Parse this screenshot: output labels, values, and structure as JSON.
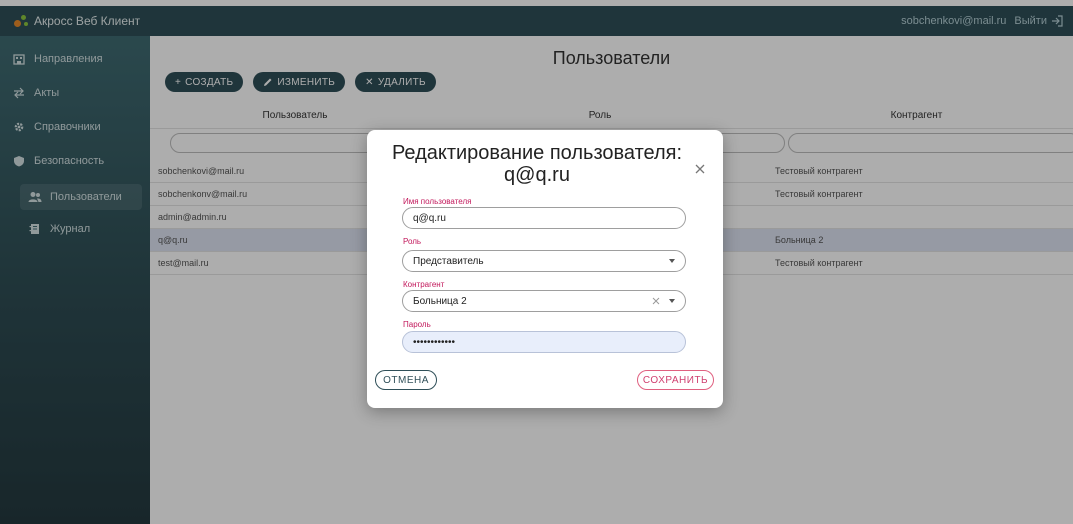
{
  "app": {
    "title": "Акросс Веб Клиент",
    "user_email": "sobchenkovi@mail.ru",
    "logout_label": "Выйти"
  },
  "sidebar": {
    "items": [
      {
        "label": "Направления",
        "icon": "building-icon"
      },
      {
        "label": "Акты",
        "icon": "transfer-icon"
      },
      {
        "label": "Справочники",
        "icon": "gear-icon"
      },
      {
        "label": "Безопасность",
        "icon": "shield-icon"
      },
      {
        "label": "Пользователи",
        "icon": "users-icon",
        "active": true
      },
      {
        "label": "Журнал",
        "icon": "journal-icon"
      }
    ]
  },
  "main": {
    "title": "Пользователи",
    "toolbar": {
      "create_label": "СОЗДАТЬ",
      "edit_label": "ИЗМЕНИТЬ",
      "delete_label": "УДАЛИТЬ"
    },
    "table": {
      "columns": [
        "Пользователь",
        "Роль",
        "Контрагент"
      ],
      "rows": [
        {
          "user": "sobchenkovi@mail.ru",
          "role": "",
          "contractor": "Тестовый контрагент"
        },
        {
          "user": "sobchenkonv@mail.ru",
          "role": "",
          "contractor": "Тестовый контрагент"
        },
        {
          "user": "admin@admin.ru",
          "role": "",
          "contractor": ""
        },
        {
          "user": "q@q.ru",
          "role": "",
          "contractor": "Больница 2"
        },
        {
          "user": "test@mail.ru",
          "role": "",
          "contractor": "Тестовый контрагент"
        }
      ]
    }
  },
  "modal": {
    "title_line1": "Редактирование пользователя:",
    "title_line2": "q@q.ru",
    "username_label": "Имя пользователя",
    "username_value": "q@q.ru",
    "role_label": "Роль",
    "role_value": "Представитель",
    "contractor_label": "Контрагент",
    "contractor_value": "Больница 2",
    "password_label": "Пароль",
    "password_value": "••••••••••••",
    "cancel_label": "ОТМЕНА",
    "save_label": "СОХРАНИТЬ"
  },
  "colors": {
    "appbar": "#2f4f58",
    "accent_pink": "#c2185b",
    "selected_row": "#dde3f2"
  }
}
